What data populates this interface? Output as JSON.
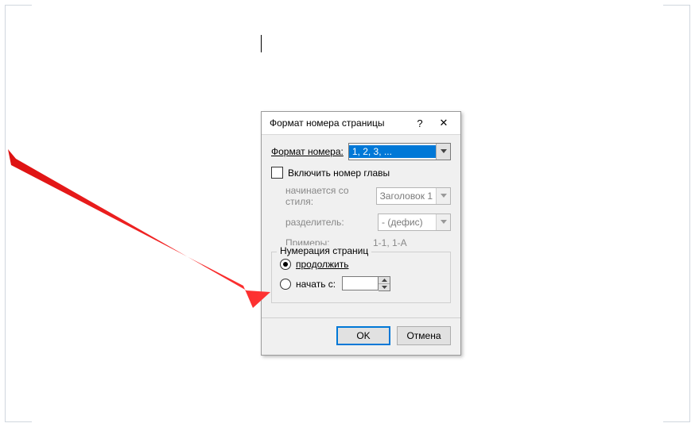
{
  "dialog": {
    "title": "Формат номера страницы",
    "help": "?",
    "close": "✕",
    "format_label": "Формат номера:",
    "format_value": "1, 2, 3, ...",
    "include_chapter": "Включить номер главы",
    "starts_with_style_label": "начинается со стиля:",
    "starts_with_style_value": "Заголовок 1",
    "separator_label": "разделитель:",
    "separator_value": "-   (дефис)",
    "examples_label": "Примеры:",
    "examples_value": "1-1, 1-A",
    "group_title": "Нумерация страниц",
    "radio_continue": "продолжить",
    "radio_start_at": "начать с:",
    "start_value": "",
    "ok": "OK",
    "cancel": "Отмена"
  }
}
